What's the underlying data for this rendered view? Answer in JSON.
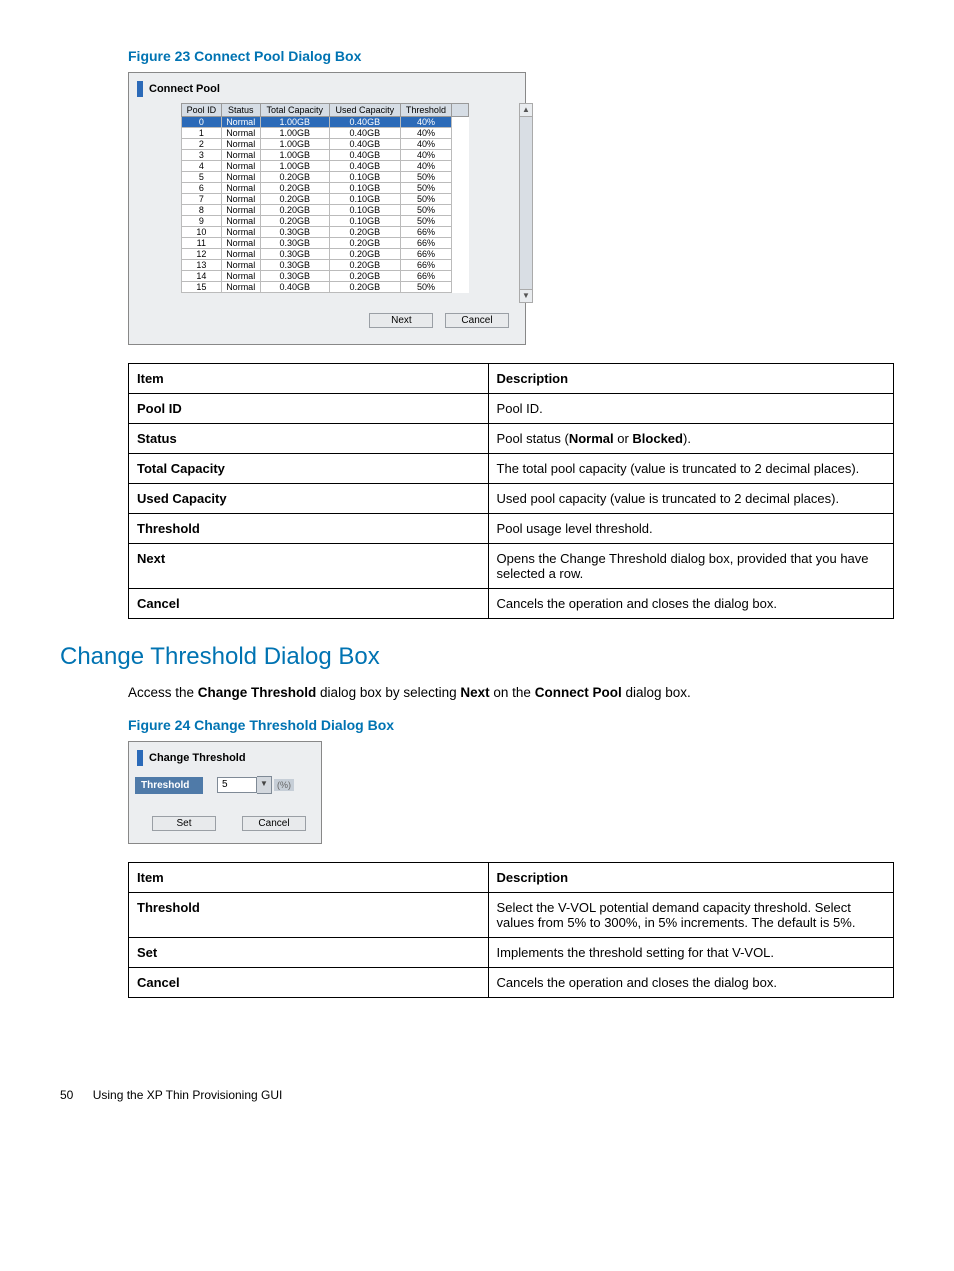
{
  "figure23": {
    "caption": "Figure 23 Connect Pool Dialog Box",
    "dialog": {
      "title": "Connect Pool",
      "columns": [
        "Pool ID",
        "Status",
        "Total Capacity",
        "Used Capacity",
        "Threshold"
      ],
      "rows": [
        {
          "id": "0",
          "status": "Normal",
          "total": "1.00GB",
          "used": "0.40GB",
          "threshold": "40%",
          "selected": true
        },
        {
          "id": "1",
          "status": "Normal",
          "total": "1.00GB",
          "used": "0.40GB",
          "threshold": "40%"
        },
        {
          "id": "2",
          "status": "Normal",
          "total": "1.00GB",
          "used": "0.40GB",
          "threshold": "40%"
        },
        {
          "id": "3",
          "status": "Normal",
          "total": "1.00GB",
          "used": "0.40GB",
          "threshold": "40%"
        },
        {
          "id": "4",
          "status": "Normal",
          "total": "1.00GB",
          "used": "0.40GB",
          "threshold": "40%"
        },
        {
          "id": "5",
          "status": "Normal",
          "total": "0.20GB",
          "used": "0.10GB",
          "threshold": "50%"
        },
        {
          "id": "6",
          "status": "Normal",
          "total": "0.20GB",
          "used": "0.10GB",
          "threshold": "50%"
        },
        {
          "id": "7",
          "status": "Normal",
          "total": "0.20GB",
          "used": "0.10GB",
          "threshold": "50%"
        },
        {
          "id": "8",
          "status": "Normal",
          "total": "0.20GB",
          "used": "0.10GB",
          "threshold": "50%"
        },
        {
          "id": "9",
          "status": "Normal",
          "total": "0.20GB",
          "used": "0.10GB",
          "threshold": "50%"
        },
        {
          "id": "10",
          "status": "Normal",
          "total": "0.30GB",
          "used": "0.20GB",
          "threshold": "66%"
        },
        {
          "id": "11",
          "status": "Normal",
          "total": "0.30GB",
          "used": "0.20GB",
          "threshold": "66%"
        },
        {
          "id": "12",
          "status": "Normal",
          "total": "0.30GB",
          "used": "0.20GB",
          "threshold": "66%"
        },
        {
          "id": "13",
          "status": "Normal",
          "total": "0.30GB",
          "used": "0.20GB",
          "threshold": "66%"
        },
        {
          "id": "14",
          "status": "Normal",
          "total": "0.30GB",
          "used": "0.20GB",
          "threshold": "66%"
        },
        {
          "id": "15",
          "status": "Normal",
          "total": "0.40GB",
          "used": "0.20GB",
          "threshold": "50%"
        }
      ],
      "buttons": {
        "next": "Next",
        "cancel": "Cancel"
      }
    },
    "desc_table": {
      "headers": [
        "Item",
        "Description"
      ],
      "rows": [
        {
          "item": "Pool ID",
          "desc": "Pool ID."
        },
        {
          "item": "Status",
          "desc_html": "Pool status (<b>Normal</b> or <b>Blocked</b>)."
        },
        {
          "item": "Total Capacity",
          "desc": "The total pool capacity (value is truncated to 2 decimal places)."
        },
        {
          "item": "Used Capacity",
          "desc": "Used pool capacity (value is truncated to 2 decimal places)."
        },
        {
          "item": "Threshold",
          "desc": "Pool usage level threshold."
        },
        {
          "item": "Next",
          "desc": "Opens the Change Threshold dialog box, provided that you have selected a row."
        },
        {
          "item": "Cancel",
          "desc": "Cancels the operation and closes the dialog box."
        }
      ]
    }
  },
  "section2": {
    "heading": "Change Threshold Dialog Box",
    "intro_html": "Access the <b>Change Threshold</b> dialog box by selecting <b>Next</b> on the <b>Connect Pool</b> dialog box."
  },
  "figure24": {
    "caption": "Figure 24 Change Threshold Dialog Box",
    "dialog": {
      "title": "Change Threshold",
      "field_label": "Threshold",
      "field_value": "5",
      "unit": "(%)",
      "buttons": {
        "set": "Set",
        "cancel": "Cancel"
      }
    },
    "desc_table": {
      "headers": [
        "Item",
        "Description"
      ],
      "rows": [
        {
          "item": "Threshold",
          "desc": "Select the V-VOL potential demand capacity threshold. Select values from 5% to 300%, in 5% increments. The default is 5%."
        },
        {
          "item": "Set",
          "desc": "Implements the threshold setting for that V-VOL."
        },
        {
          "item": "Cancel",
          "desc": "Cancels the operation and closes the dialog box."
        }
      ]
    }
  },
  "footer": {
    "page": "50",
    "section": "Using the XP Thin Provisioning GUI"
  }
}
